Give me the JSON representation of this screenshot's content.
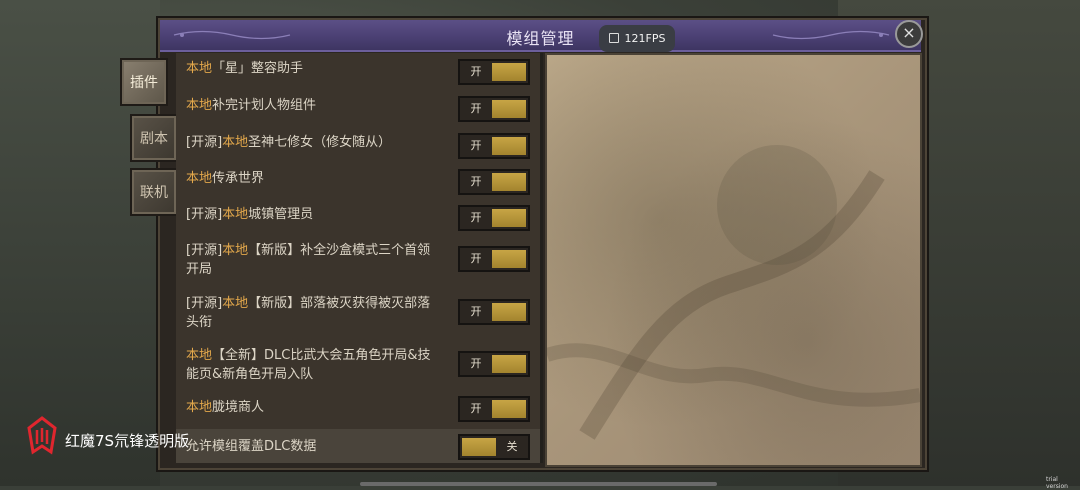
{
  "window": {
    "title": "模组管理",
    "close": "×"
  },
  "fps": {
    "label": "121FPS"
  },
  "side_tabs": [
    {
      "label": "插件",
      "active": true
    },
    {
      "label": "剧本",
      "active": false
    },
    {
      "label": "联机",
      "active": false
    }
  ],
  "mods": [
    {
      "prefix": "",
      "tag": "本地",
      "rest_line1": "「星」整容助手",
      "line2": "",
      "toggle": "开"
    },
    {
      "prefix": "",
      "tag": "本地",
      "rest_line1": "补完计划人物组件",
      "line2": "",
      "toggle": "开"
    },
    {
      "prefix": "[开源]",
      "tag": "本地",
      "rest_line1": "圣神七修女（修女随从）",
      "line2": "",
      "toggle": "开"
    },
    {
      "prefix": "",
      "tag": "本地",
      "rest_line1": "传承世界",
      "line2": "",
      "toggle": "开"
    },
    {
      "prefix": "[开源]",
      "tag": "本地",
      "rest_line1": "城镇管理员",
      "line2": "",
      "toggle": "开"
    },
    {
      "prefix": "[开源]",
      "tag": "本地",
      "rest_line1": "【新版】补全沙盒模式三个首领",
      "line2": "开局",
      "toggle": "开"
    },
    {
      "prefix": "[开源]",
      "tag": "本地",
      "rest_line1": "【新版】部落被灭获得被灭部落",
      "line2": "头衔",
      "toggle": "开"
    },
    {
      "prefix": "",
      "tag": "本地",
      "rest_line1": "【全新】DLC比武大会五角色开局&技",
      "line2": "能页&新角色开局入队",
      "toggle": "开"
    },
    {
      "prefix": "",
      "tag": "本地",
      "rest_line1": "胧境商人",
      "line2": "",
      "toggle": "开"
    }
  ],
  "dlc_override": {
    "label": "允许模组覆盖DLC数据",
    "toggle": "关"
  },
  "watermark": {
    "text": "红魔7S氘锋透明版"
  },
  "trial": {
    "text": "trial version"
  },
  "colors": {
    "accent": "#e3a84b",
    "toggle_on": "#c7a545",
    "title_bar": "#4a3f72"
  }
}
